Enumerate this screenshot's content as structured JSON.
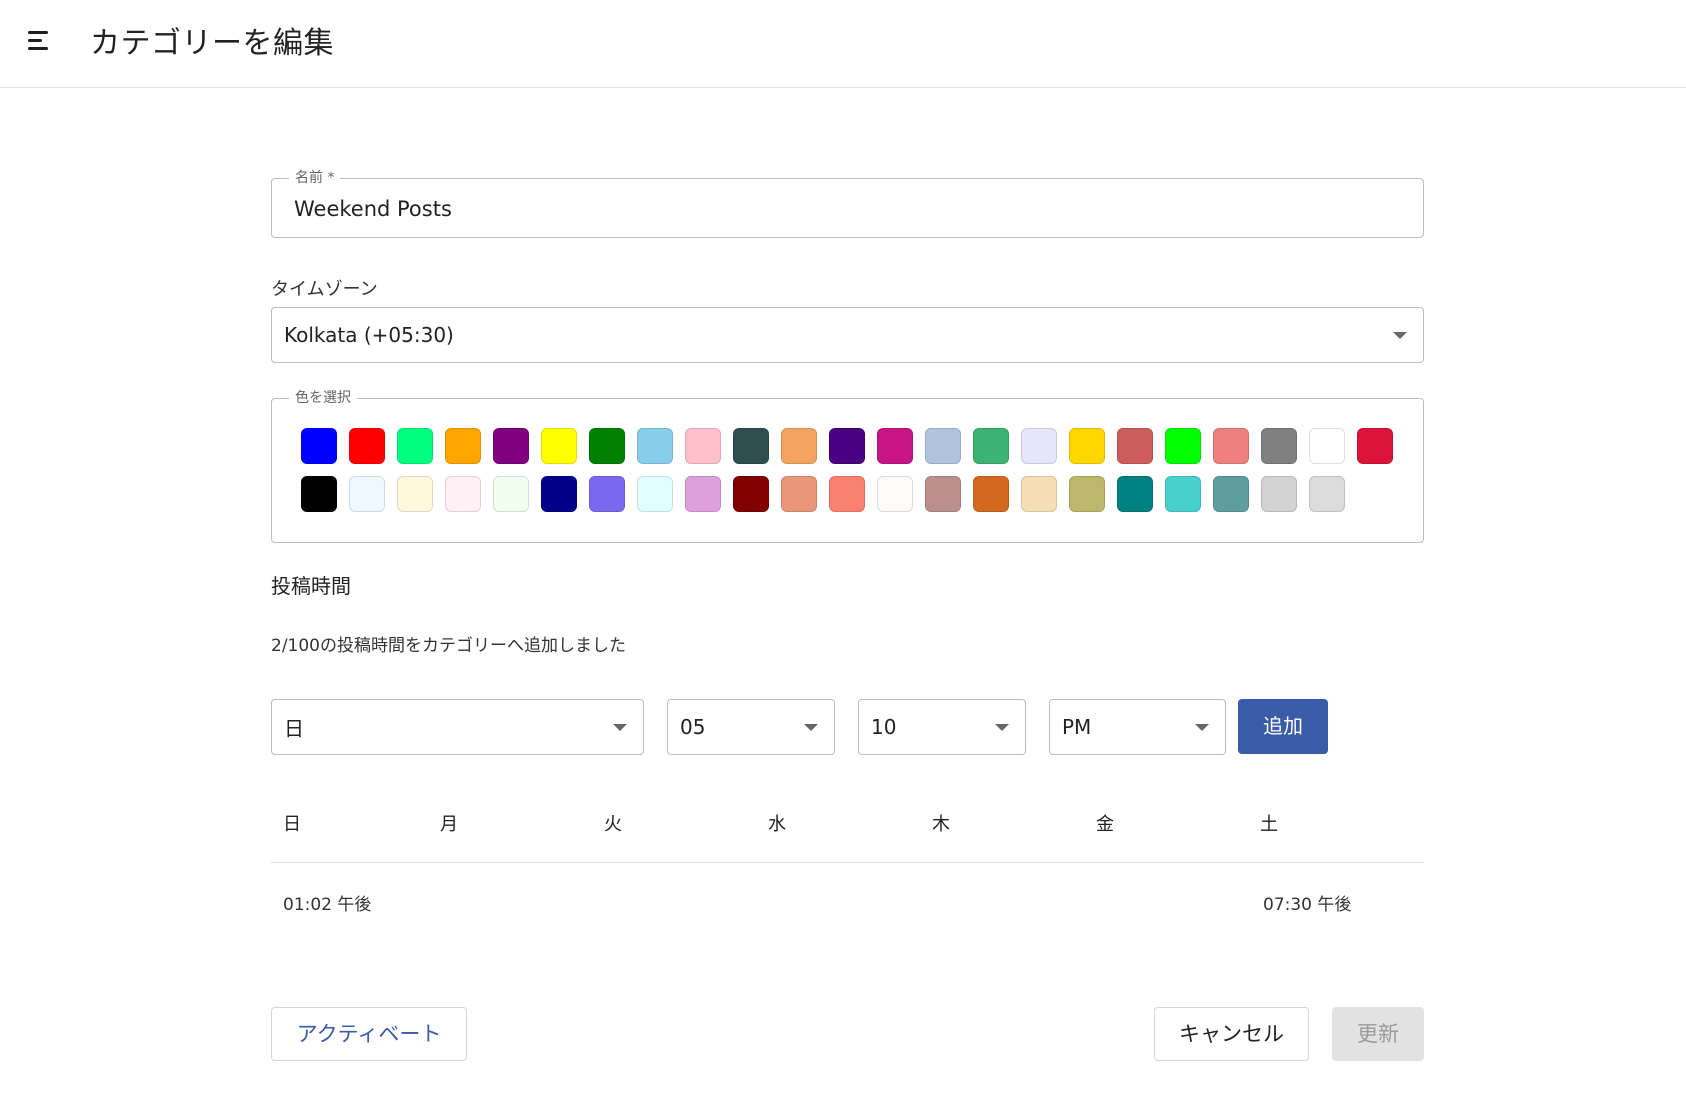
{
  "header": {
    "title": "カテゴリーを編集"
  },
  "form": {
    "name": {
      "legend": "名前 *",
      "value": "Weekend Posts"
    },
    "timezone": {
      "label": "タイムゾーン",
      "value": "Kolkata (+05:30)"
    },
    "color_picker": {
      "legend": "色を選択",
      "row1": [
        "#0000ff",
        "#ff0000",
        "#00ff7f",
        "#ffa500",
        "#800080",
        "#ffff00",
        "#008000",
        "#87ceeb",
        "#ffc0cb",
        "#2f4f4f",
        "#f4a460",
        "#4b0082",
        "#c71585",
        "#b0c4de",
        "#3cb371",
        "#e6e6fa",
        "#ffd700",
        "#cd5c5c",
        "#00ff00",
        "#f08080",
        "#808080",
        "#ffffff",
        "#dc143c"
      ],
      "row2": [
        "#000000",
        "#f0f8ff",
        "#fff8dc",
        "#fff0f5",
        "#f0fff0",
        "#00008b",
        "#7b68ee",
        "#e0ffff",
        "#dda0dd",
        "#800000",
        "#e9967a",
        "#fa8072",
        "#fffafa",
        "#bc8f8f",
        "#d2691e",
        "#f5deb3",
        "#bdb76b",
        "#008080",
        "#48d1cc",
        "#5f9ea0",
        "#d3d3d3",
        "#dcdcdc"
      ]
    }
  },
  "posting_times": {
    "title": "投稿時間",
    "info": "2/100の投稿時間をカテゴリーへ追加しました",
    "day_select": "日",
    "hour_select": "05",
    "minute_select": "10",
    "ampm_select": "PM",
    "add_label": "追加",
    "weekdays": [
      "日",
      "月",
      "火",
      "水",
      "木",
      "金",
      "土"
    ],
    "entries": {
      "sun": "01:02 午後",
      "sat": "07:30 午後"
    }
  },
  "actions": {
    "activate_label": "アクティベート",
    "cancel_label": "キャンセル",
    "update_label": "更新"
  }
}
